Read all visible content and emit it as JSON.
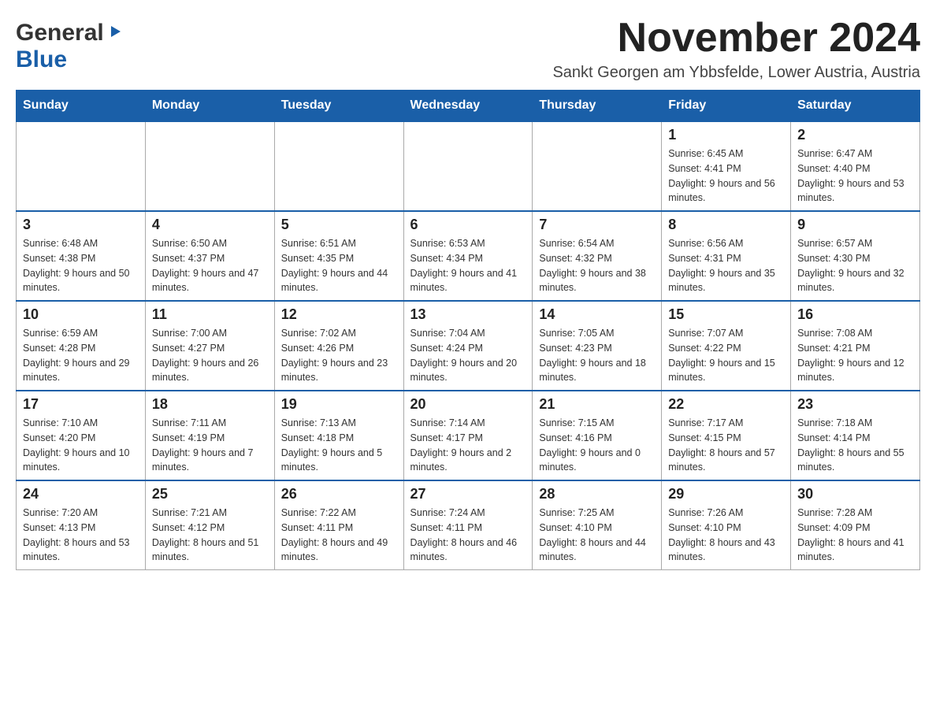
{
  "header": {
    "logo_general": "General",
    "logo_blue": "Blue",
    "month_title": "November 2024",
    "location": "Sankt Georgen am Ybbsfelde, Lower Austria, Austria"
  },
  "weekdays": [
    "Sunday",
    "Monday",
    "Tuesday",
    "Wednesday",
    "Thursday",
    "Friday",
    "Saturday"
  ],
  "weeks": [
    [
      {
        "day": "",
        "sunrise": "",
        "sunset": "",
        "daylight": ""
      },
      {
        "day": "",
        "sunrise": "",
        "sunset": "",
        "daylight": ""
      },
      {
        "day": "",
        "sunrise": "",
        "sunset": "",
        "daylight": ""
      },
      {
        "day": "",
        "sunrise": "",
        "sunset": "",
        "daylight": ""
      },
      {
        "day": "",
        "sunrise": "",
        "sunset": "",
        "daylight": ""
      },
      {
        "day": "1",
        "sunrise": "Sunrise: 6:45 AM",
        "sunset": "Sunset: 4:41 PM",
        "daylight": "Daylight: 9 hours and 56 minutes."
      },
      {
        "day": "2",
        "sunrise": "Sunrise: 6:47 AM",
        "sunset": "Sunset: 4:40 PM",
        "daylight": "Daylight: 9 hours and 53 minutes."
      }
    ],
    [
      {
        "day": "3",
        "sunrise": "Sunrise: 6:48 AM",
        "sunset": "Sunset: 4:38 PM",
        "daylight": "Daylight: 9 hours and 50 minutes."
      },
      {
        "day": "4",
        "sunrise": "Sunrise: 6:50 AM",
        "sunset": "Sunset: 4:37 PM",
        "daylight": "Daylight: 9 hours and 47 minutes."
      },
      {
        "day": "5",
        "sunrise": "Sunrise: 6:51 AM",
        "sunset": "Sunset: 4:35 PM",
        "daylight": "Daylight: 9 hours and 44 minutes."
      },
      {
        "day": "6",
        "sunrise": "Sunrise: 6:53 AM",
        "sunset": "Sunset: 4:34 PM",
        "daylight": "Daylight: 9 hours and 41 minutes."
      },
      {
        "day": "7",
        "sunrise": "Sunrise: 6:54 AM",
        "sunset": "Sunset: 4:32 PM",
        "daylight": "Daylight: 9 hours and 38 minutes."
      },
      {
        "day": "8",
        "sunrise": "Sunrise: 6:56 AM",
        "sunset": "Sunset: 4:31 PM",
        "daylight": "Daylight: 9 hours and 35 minutes."
      },
      {
        "day": "9",
        "sunrise": "Sunrise: 6:57 AM",
        "sunset": "Sunset: 4:30 PM",
        "daylight": "Daylight: 9 hours and 32 minutes."
      }
    ],
    [
      {
        "day": "10",
        "sunrise": "Sunrise: 6:59 AM",
        "sunset": "Sunset: 4:28 PM",
        "daylight": "Daylight: 9 hours and 29 minutes."
      },
      {
        "day": "11",
        "sunrise": "Sunrise: 7:00 AM",
        "sunset": "Sunset: 4:27 PM",
        "daylight": "Daylight: 9 hours and 26 minutes."
      },
      {
        "day": "12",
        "sunrise": "Sunrise: 7:02 AM",
        "sunset": "Sunset: 4:26 PM",
        "daylight": "Daylight: 9 hours and 23 minutes."
      },
      {
        "day": "13",
        "sunrise": "Sunrise: 7:04 AM",
        "sunset": "Sunset: 4:24 PM",
        "daylight": "Daylight: 9 hours and 20 minutes."
      },
      {
        "day": "14",
        "sunrise": "Sunrise: 7:05 AM",
        "sunset": "Sunset: 4:23 PM",
        "daylight": "Daylight: 9 hours and 18 minutes."
      },
      {
        "day": "15",
        "sunrise": "Sunrise: 7:07 AM",
        "sunset": "Sunset: 4:22 PM",
        "daylight": "Daylight: 9 hours and 15 minutes."
      },
      {
        "day": "16",
        "sunrise": "Sunrise: 7:08 AM",
        "sunset": "Sunset: 4:21 PM",
        "daylight": "Daylight: 9 hours and 12 minutes."
      }
    ],
    [
      {
        "day": "17",
        "sunrise": "Sunrise: 7:10 AM",
        "sunset": "Sunset: 4:20 PM",
        "daylight": "Daylight: 9 hours and 10 minutes."
      },
      {
        "day": "18",
        "sunrise": "Sunrise: 7:11 AM",
        "sunset": "Sunset: 4:19 PM",
        "daylight": "Daylight: 9 hours and 7 minutes."
      },
      {
        "day": "19",
        "sunrise": "Sunrise: 7:13 AM",
        "sunset": "Sunset: 4:18 PM",
        "daylight": "Daylight: 9 hours and 5 minutes."
      },
      {
        "day": "20",
        "sunrise": "Sunrise: 7:14 AM",
        "sunset": "Sunset: 4:17 PM",
        "daylight": "Daylight: 9 hours and 2 minutes."
      },
      {
        "day": "21",
        "sunrise": "Sunrise: 7:15 AM",
        "sunset": "Sunset: 4:16 PM",
        "daylight": "Daylight: 9 hours and 0 minutes."
      },
      {
        "day": "22",
        "sunrise": "Sunrise: 7:17 AM",
        "sunset": "Sunset: 4:15 PM",
        "daylight": "Daylight: 8 hours and 57 minutes."
      },
      {
        "day": "23",
        "sunrise": "Sunrise: 7:18 AM",
        "sunset": "Sunset: 4:14 PM",
        "daylight": "Daylight: 8 hours and 55 minutes."
      }
    ],
    [
      {
        "day": "24",
        "sunrise": "Sunrise: 7:20 AM",
        "sunset": "Sunset: 4:13 PM",
        "daylight": "Daylight: 8 hours and 53 minutes."
      },
      {
        "day": "25",
        "sunrise": "Sunrise: 7:21 AM",
        "sunset": "Sunset: 4:12 PM",
        "daylight": "Daylight: 8 hours and 51 minutes."
      },
      {
        "day": "26",
        "sunrise": "Sunrise: 7:22 AM",
        "sunset": "Sunset: 4:11 PM",
        "daylight": "Daylight: 8 hours and 49 minutes."
      },
      {
        "day": "27",
        "sunrise": "Sunrise: 7:24 AM",
        "sunset": "Sunset: 4:11 PM",
        "daylight": "Daylight: 8 hours and 46 minutes."
      },
      {
        "day": "28",
        "sunrise": "Sunrise: 7:25 AM",
        "sunset": "Sunset: 4:10 PM",
        "daylight": "Daylight: 8 hours and 44 minutes."
      },
      {
        "day": "29",
        "sunrise": "Sunrise: 7:26 AM",
        "sunset": "Sunset: 4:10 PM",
        "daylight": "Daylight: 8 hours and 43 minutes."
      },
      {
        "day": "30",
        "sunrise": "Sunrise: 7:28 AM",
        "sunset": "Sunset: 4:09 PM",
        "daylight": "Daylight: 8 hours and 41 minutes."
      }
    ]
  ]
}
